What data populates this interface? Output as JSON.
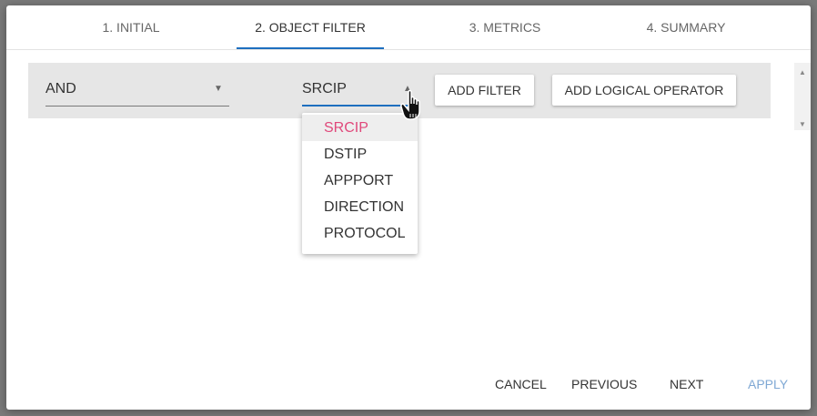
{
  "tabs": [
    {
      "label": "1. INITIAL"
    },
    {
      "label": "2. OBJECT FILTER",
      "active": true
    },
    {
      "label": "3. METRICS"
    },
    {
      "label": "4. SUMMARY"
    }
  ],
  "filter_row": {
    "operator_value": "AND",
    "field_value": "SRCIP",
    "add_filter_label": "ADD FILTER",
    "add_logical_operator_label": "ADD LOGICAL OPERATOR"
  },
  "field_dropdown": {
    "options": [
      "SRCIP",
      "DSTIP",
      "APPPORT",
      "DIRECTION",
      "PROTOCOL"
    ],
    "selected": "SRCIP"
  },
  "footer": {
    "cancel_label": "CANCEL",
    "previous_label": "PREVIOUS",
    "next_label": "NEXT",
    "apply_label": "APPLY"
  },
  "colors": {
    "accent": "#1e6fbf",
    "selected_option": "#e0497b",
    "disabled_text": "#7fa8d4",
    "filter_row_bg": "#e6e6e6"
  }
}
